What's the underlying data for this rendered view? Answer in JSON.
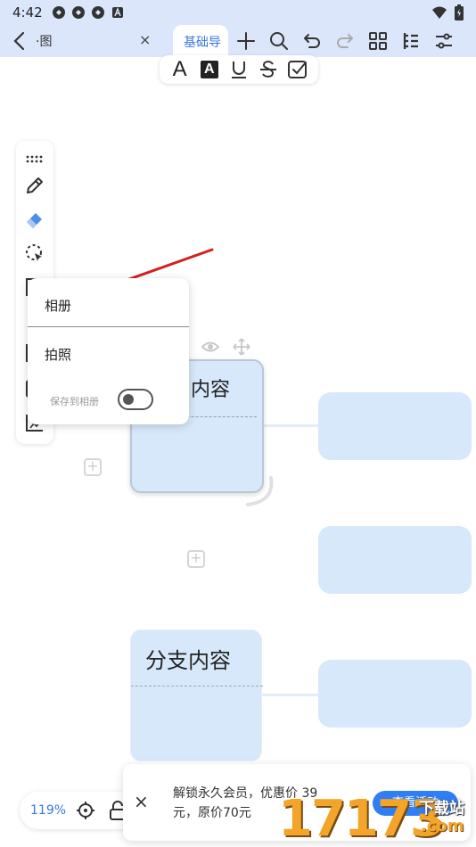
{
  "status_bar": {
    "time": "4:42",
    "icons": [
      "notification-icon",
      "notification-icon",
      "notification-icon",
      "a-icon",
      "wifi-icon",
      "battery-icon"
    ]
  },
  "top_bar": {
    "doc_tab_label": "·图",
    "close_symbol": "×",
    "active_tab_label": "基础导",
    "tools": [
      "plus-icon",
      "search-icon",
      "undo-icon",
      "redo-icon",
      "grid-icon",
      "outline-icon",
      "settings-sliders-icon"
    ]
  },
  "format_bar": {
    "tools": [
      "text-a-icon",
      "text-highlight-icon",
      "underline-icon",
      "strikethrough-icon",
      "checkbox-icon"
    ],
    "text_a": "A",
    "highlight_a": "A"
  },
  "side_tools": [
    "drag-handle-icon",
    "pen-icon",
    "eraser-icon",
    "lasso-icon",
    "frame-icon",
    "image-icon",
    "shape-icon",
    "crop-icon"
  ],
  "insert_popup": {
    "album": "相册",
    "camera": "拍照",
    "save_to_album": "保存到相册",
    "save_to_album_on": false
  },
  "mindmap": {
    "central_node_text": "内容",
    "branch_node_text": "分支内容"
  },
  "zoom": {
    "level": "119%"
  },
  "promo": {
    "close_symbol": "×",
    "text": "解锁永久会员，优惠价 39 元，原价70元",
    "button_label": "查看活动"
  },
  "watermark": {
    "number": "17173",
    "site": "下载站",
    "domain": ".com"
  },
  "colors": {
    "accent": "#3a78e0",
    "toolbar_bg": "#dbe6fb",
    "node_fill": "#d7e8fa",
    "arrow": "#d42020",
    "promo_button": "#2f7ef5"
  }
}
